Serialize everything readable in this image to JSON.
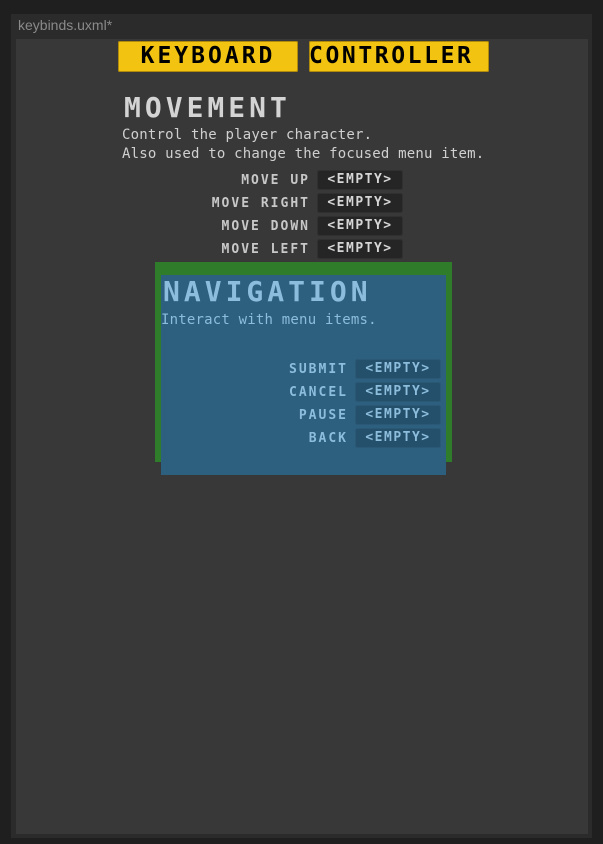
{
  "window": {
    "title": "keybinds.uxml*"
  },
  "tabs": [
    {
      "label": "Keyboard"
    },
    {
      "label": "Controller"
    }
  ],
  "colors": {
    "tab_accent": "#f2c311",
    "navigation_border": "#2f7d2a",
    "navigation_bg": "#2d5f7e",
    "navigation_text": "#8cbddc"
  },
  "sections": [
    {
      "title": "Movement",
      "description": [
        "Control the player character.",
        "Also used to change the focused menu item."
      ],
      "bindings": [
        {
          "label": "Move Up",
          "value": "<Empty>"
        },
        {
          "label": "Move Right",
          "value": "<Empty>"
        },
        {
          "label": "Move Down",
          "value": "<Empty>"
        },
        {
          "label": "Move Left",
          "value": "<Empty>"
        }
      ]
    },
    {
      "title": "Navigation",
      "description": [
        "Interact with menu items."
      ],
      "bindings": [
        {
          "label": "Submit",
          "value": "<Empty>"
        },
        {
          "label": "Cancel",
          "value": "<Empty>"
        },
        {
          "label": "Pause",
          "value": "<Empty>"
        },
        {
          "label": "Back",
          "value": "<Empty>"
        }
      ]
    }
  ]
}
